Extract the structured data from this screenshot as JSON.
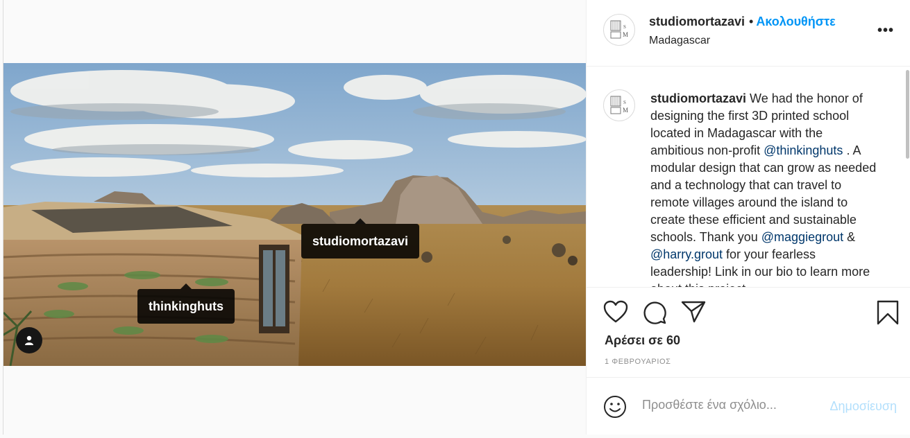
{
  "account": {
    "username": "studiomortazavi",
    "dot": "•",
    "follow_label": "Ακολουθήστε",
    "location": "Madagascar",
    "more_label": "•••",
    "avatar_lines": [
      "S",
      "M"
    ]
  },
  "photo_tags": {
    "studio": "studiomortazavi",
    "thinking": "thinkinghuts"
  },
  "caption": {
    "username": "studiomortazavi",
    "part1": " We had the honor of designing the first 3D printed school located in Madagascar with the ambitious non-profit ",
    "mention1": "@thinkinghuts",
    "part2": " . A modular design that can grow as needed and a technology that can travel to remote villages around the island to create these efficient and sustainable schools. Thank you ",
    "mention2": "@maggiegrout",
    "part3": " & ",
    "mention3": "@harry.grout",
    "part4": " for your fearless leadership! Link in our bio to learn more about this project."
  },
  "engagement": {
    "likes": "Αρέσει σε 60",
    "date": "1 ΦΕΒΡΟΥΑΡΙΟΣ"
  },
  "comment_box": {
    "placeholder": "Προσθέστε ένα σχόλιο...",
    "post_label": "Δημοσίευση"
  },
  "colors": {
    "accent": "#0095f6",
    "mention": "#00376b",
    "disabled_post": "#b2dffc"
  },
  "icons": {
    "like": "heart-icon",
    "comment": "comment-icon",
    "share": "share-icon",
    "save": "bookmark-icon",
    "emoji": "emoji-icon",
    "tagged_users": "user-icon"
  }
}
